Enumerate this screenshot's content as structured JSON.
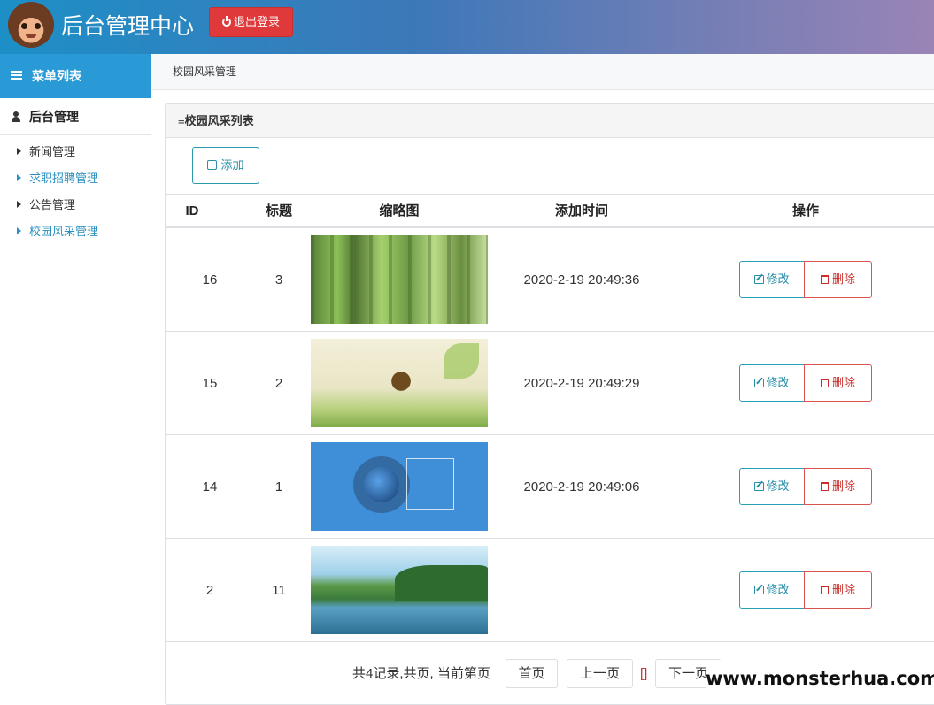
{
  "header": {
    "title": "后台管理中心",
    "logout_label": "退出登录"
  },
  "sidebar": {
    "menu_title": "菜单列表",
    "group_title": "后台管理",
    "items": [
      {
        "label": "新闻管理"
      },
      {
        "label": "求职招聘管理"
      },
      {
        "label": "公告管理"
      },
      {
        "label": "校园风采管理"
      }
    ]
  },
  "breadcrumb": "校园风采管理",
  "panel": {
    "title": "≡校园风采列表",
    "add_label": "添加"
  },
  "table": {
    "columns": [
      "ID",
      "标题",
      "缩略图",
      "添加时间",
      "操作"
    ],
    "edit_label": "修改",
    "delete_label": "删除",
    "rows": [
      {
        "id": "16",
        "title": "3",
        "time": "2020-2-19 20:49:36"
      },
      {
        "id": "15",
        "title": "2",
        "time": "2020-2-19 20:49:29"
      },
      {
        "id": "14",
        "title": "1",
        "time": "2020-2-19 20:49:06"
      },
      {
        "id": "2",
        "title": "11",
        "time": ""
      }
    ]
  },
  "pagination": {
    "summary": "共4记录,共页, 当前第页",
    "first": "首页",
    "prev": "上一页",
    "current": "[]",
    "next": "下一页"
  },
  "watermark": "www.monsterhua.com",
  "colors": {
    "accent": "#2a9ad6",
    "danger": "#e0393b",
    "edit": "#2a8fa8"
  }
}
